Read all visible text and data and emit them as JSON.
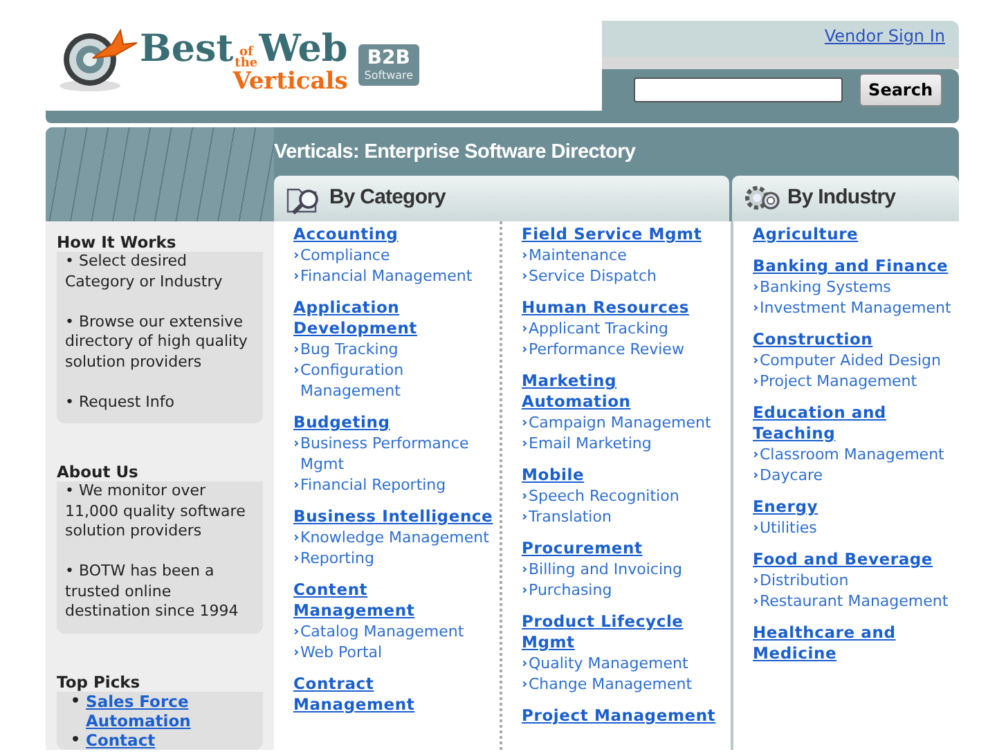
{
  "logo": {
    "best": "Best",
    "of": "of",
    "the": "the",
    "web": "Web",
    "verticals": "Verticals",
    "badge_title": "B2B",
    "badge_subtitle": "Software"
  },
  "header": {
    "vendor_link": "Vendor Sign In",
    "search_button": "Search"
  },
  "page_title": "Verticals: Enterprise Software Directory",
  "sidebar": [
    {
      "heading": "How It Works",
      "kind": "text",
      "items": [
        "• Select desired Category or Industry",
        "• Browse our extensive directory of high quality solution providers",
        "• Request Info"
      ]
    },
    {
      "heading": "About Us",
      "kind": "text",
      "items": [
        "• We monitor over 11,000 quality software solution providers",
        "• BOTW has been a trusted online destination since 1994"
      ]
    },
    {
      "heading": "Top Picks",
      "kind": "links",
      "bullet": "•",
      "items": [
        "Sales Force Automation",
        "Contact"
      ]
    }
  ],
  "category_tab": {
    "label": "By Category"
  },
  "categories": {
    "column_1": [
      {
        "name": "Accounting",
        "items": [
          "Compliance",
          "Financial Management"
        ]
      },
      {
        "name": "Application Development",
        "items": [
          "Bug Tracking",
          "Configuration Management"
        ]
      },
      {
        "name": "Budgeting",
        "items": [
          "Business Performance Mgmt",
          "Financial Reporting"
        ]
      },
      {
        "name": "Business Intelligence",
        "items": [
          "Knowledge Management",
          "Reporting"
        ]
      },
      {
        "name": "Content Management",
        "items": [
          "Catalog Management",
          "Web Portal"
        ]
      },
      {
        "name": "Contract Management"
      }
    ],
    "column_2": [
      {
        "name": "Field Service Mgmt",
        "items": [
          "Maintenance",
          "Service Dispatch"
        ]
      },
      {
        "name": "Human Resources",
        "items": [
          "Applicant Tracking",
          "Performance Review"
        ]
      },
      {
        "name": "Marketing Automation",
        "items": [
          "Campaign Management",
          "Email Marketing"
        ]
      },
      {
        "name": "Mobile",
        "items": [
          "Speech Recognition",
          "Translation"
        ]
      },
      {
        "name": "Procurement",
        "items": [
          "Billing and Invoicing",
          "Purchasing"
        ]
      },
      {
        "name": "Product Lifecycle Mgmt",
        "items": [
          "Quality Management",
          "Change Management"
        ]
      },
      {
        "name": "Project Management"
      }
    ]
  },
  "industry_tab": {
    "label": "By Industry"
  },
  "industries": [
    {
      "name": "Agriculture"
    },
    {
      "name": "Banking and Finance",
      "items": [
        "Banking Systems",
        "Investment Management"
      ]
    },
    {
      "name": "Construction",
      "items": [
        "Computer Aided Design",
        "Project Management"
      ]
    },
    {
      "name": "Education and Teaching",
      "items": [
        "Classroom Management",
        "Daycare"
      ]
    },
    {
      "name": "Energy",
      "items": [
        "Utilities"
      ]
    },
    {
      "name": "Food and Beverage",
      "items": [
        "Distribution",
        "Restaurant Management"
      ]
    },
    {
      "name": "Healthcare and Medicine"
    }
  ]
}
